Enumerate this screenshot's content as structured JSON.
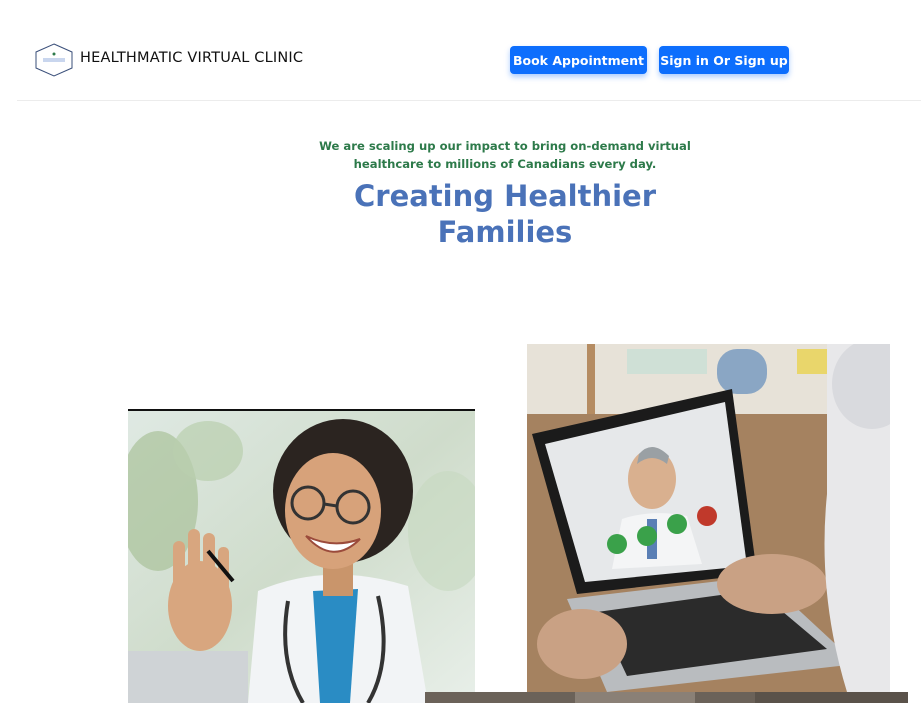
{
  "header": {
    "brand": "HEALTHMATIC VIRTUAL CLINIC",
    "logo_text": "HEALTHMATIC VIRTUAL CLINIC",
    "book_label": "Book Appointment",
    "sign_label": "Sign in Or Sign up"
  },
  "hero": {
    "tagline": "We are scaling up our impact to bring on-demand virtual healthcare to millions of Canadians every day.",
    "headline": "Creating Healthier Families"
  },
  "images": {
    "left": "doctor-waving-photo",
    "right": "telehealth-laptop-photo",
    "bottom": "partial-photo"
  },
  "colors": {
    "accent": "#0d6efd",
    "tagline": "#2d7a4a",
    "headline": "#4a72b8"
  }
}
